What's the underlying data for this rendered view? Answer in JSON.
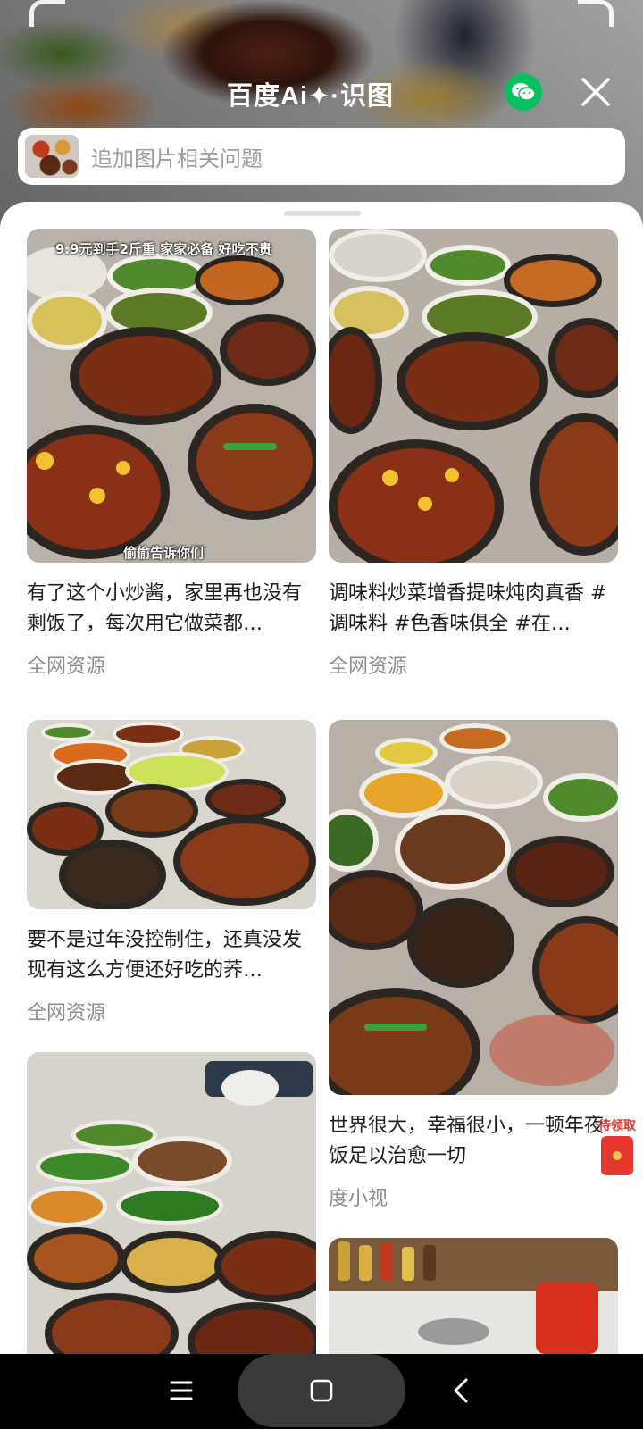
{
  "header": {
    "brand": "百度Ai✦·识图",
    "search_placeholder": "追加图片相关问题",
    "share_icon": "wechat-icon",
    "close_icon": "close-icon"
  },
  "results": [
    {
      "title": "有了这个小炒酱，家里再也没有剩饭了，每次用它做菜都…",
      "source": "全网资源",
      "overlay_top": "9.9元到手2斤重 家家必备 好吃不贵",
      "overlay_bottom": "偷偷告诉你们"
    },
    {
      "title": "调味料炒菜增香提味炖肉真香 #调味料 #色香味俱全 #在…",
      "source": "全网资源"
    },
    {
      "title": "要不是过年没控制住，还真没发现有这么方便还好吃的荞…",
      "source": "全网资源"
    },
    {
      "title": "世界很大，幸福很小，一顿年夜饭足以治愈一切",
      "source": "度小视"
    }
  ],
  "floating": {
    "redpacket_label": "待领取"
  },
  "navigation": {
    "recents_icon": "menu-icon",
    "home_icon": "home-icon",
    "back_icon": "back-icon"
  },
  "colors": {
    "wechat_green": "#07c160",
    "redpacket_red": "#e6372e",
    "source_gray": "#8a8c93"
  }
}
